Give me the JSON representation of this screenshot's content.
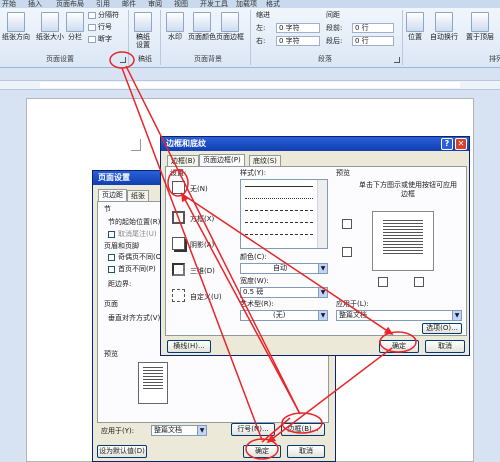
{
  "ribbon": {
    "tabs": [
      "开始",
      "插入",
      "页面布局",
      "引用",
      "邮件",
      "审阅",
      "视图",
      "开发工具",
      "加载项",
      "格式"
    ],
    "page_setup": {
      "buttons": [
        "纸张方向",
        "纸张大小",
        "分栏"
      ],
      "small": [
        "分隔符",
        "行号",
        "断字"
      ],
      "label": "页面设置"
    },
    "manuscript": {
      "button": "稿纸\n设置",
      "label": "稿纸"
    },
    "page_background": {
      "buttons": [
        "水印",
        "页面颜色",
        "页面边框"
      ],
      "label": "页面背景"
    },
    "paragraph": {
      "indent_title": "缩进",
      "spacing_title": "间距",
      "left_label": "左:",
      "left_value": "0 字符",
      "right_label": "右:",
      "right_value": "0 字符",
      "before_label": "段前:",
      "before_value": "0 行",
      "after_label": "段后:",
      "after_value": "0 行",
      "label": "段落"
    },
    "arrange": {
      "buttons": [
        "位置",
        "自动换行",
        "置于顶层"
      ],
      "label": "排列"
    }
  },
  "page_setup_dialog": {
    "title": "页面设置",
    "tabs": [
      "页边距",
      "纸张"
    ],
    "section_title": "节",
    "section_start": "节的起始位置(R):",
    "cancel_endnotes": "取消尾注(U)",
    "header_footer_title": "页眉和页脚",
    "odd_even": "奇偶页不同(O)",
    "first_page": "首页不同(P)",
    "distance": "距边界:",
    "page_title": "页面",
    "vertical_align": "垂直对齐方式(V):",
    "preview_title": "预览",
    "apply_to_label": "应用于(Y):",
    "apply_to_value": "整篇文档",
    "line_numbers_button": "行号(N)...",
    "borders_button": "边框(B)...",
    "default_button": "设为默认值(D)",
    "ok_button": "确定",
    "cancel_button": "取消"
  },
  "borders_dialog": {
    "title": "边框和底纹",
    "help": "?",
    "close": "✕",
    "tabs": [
      "边框(B)",
      "页面边框(P)",
      "底纹(S)"
    ],
    "settings_title": "设置:",
    "settings": [
      "无(N)",
      "方框(X)",
      "阴影(A)",
      "三维(D)",
      "自定义(U)"
    ],
    "style_title": "样式(Y):",
    "color_title": "颜色(C):",
    "color_value": "自动",
    "width_title": "宽度(W):",
    "width_value": "0.5 磅",
    "art_title": "艺术型(R):",
    "art_value": "(无)",
    "preview_title": "预览",
    "preview_hint": "单击下方图示或使用按钮可应用边框",
    "apply_to_label": "应用于(L):",
    "apply_to_value": "整篇文档",
    "options_button": "选项(O)...",
    "horizontal_line_button": "横线(H)...",
    "ok_button": "确定",
    "cancel_button": "取消"
  },
  "annotation_color": "#e8262a"
}
